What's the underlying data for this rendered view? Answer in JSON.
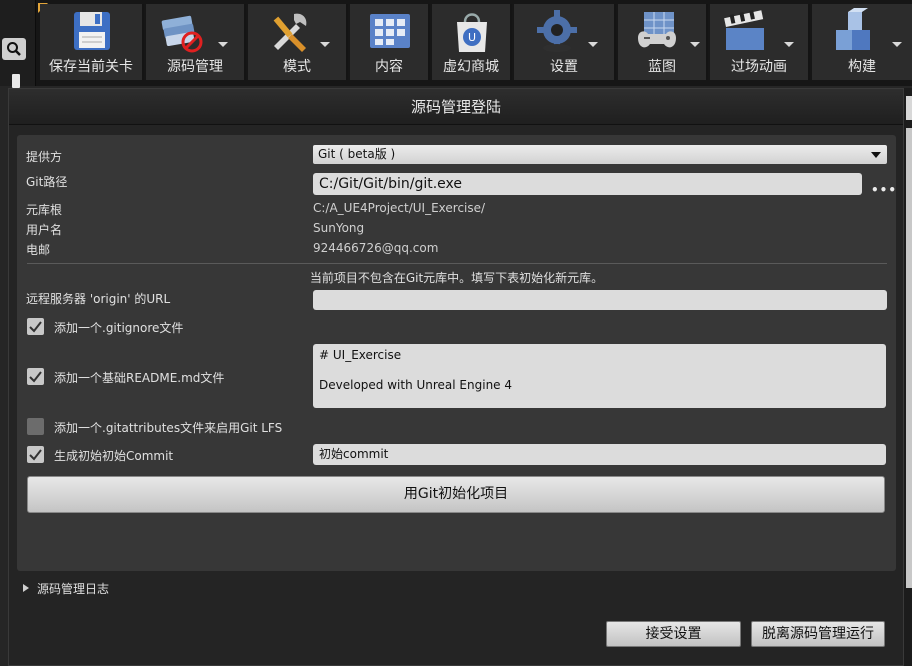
{
  "toolbar": {
    "buttons": [
      {
        "label": "保存当前关卡",
        "icon": "save-icon",
        "dropdown": false
      },
      {
        "label": "源码管理",
        "icon": "source-control-icon",
        "dropdown": true
      },
      {
        "label": "模式",
        "icon": "modes-icon",
        "dropdown": true
      },
      {
        "label": "内容",
        "icon": "content-icon",
        "dropdown": false
      },
      {
        "label": "虚幻商城",
        "icon": "marketplace-icon",
        "dropdown": false
      },
      {
        "label": "设置",
        "icon": "settings-icon",
        "dropdown": true
      },
      {
        "label": "蓝图",
        "icon": "blueprint-icon",
        "dropdown": true
      },
      {
        "label": "过场动画",
        "icon": "cinematics-icon",
        "dropdown": true
      },
      {
        "label": "构建",
        "icon": "build-icon",
        "dropdown": true
      }
    ],
    "accent": "#e2a53a"
  },
  "dialog": {
    "title": "源码管理登陆",
    "provider_label": "提供方",
    "provider_value": "Git ( beta版 )",
    "git_path_label": "Git路径",
    "git_path_value": "C:/Git/Git/bin/git.exe",
    "repo_root_label": "元库根",
    "repo_root_value": "C:/A_UE4Project/UI_Exercise/",
    "user_label": "用户名",
    "user_value": "SunYong",
    "email_label": "电邮",
    "email_value": "924466726@qq.com",
    "notice": "当前项目不包含在Git元库中。填写下表初始化新元库。",
    "remote_label": "远程服务器 'origin' 的URL",
    "remote_value": "",
    "gitignore_label": "添加一个.gitignore文件",
    "gitignore_checked": true,
    "readme_label": "添加一个基础README.md文件",
    "readme_checked": true,
    "readme_line1": "# UI_Exercise",
    "readme_line2": "Developed with Unreal Engine 4",
    "gitattributes_label": "添加一个.gitattributes文件来启用Git LFS",
    "gitattributes_checked": false,
    "commit_label": "生成初始初始Commit",
    "commit_checked": true,
    "commit_value": "初始commit",
    "init_button": "用Git初始化项目",
    "log_label": "源码管理日志",
    "accept_button": "接受设置",
    "run_without_button": "脱离源码管理运行"
  }
}
